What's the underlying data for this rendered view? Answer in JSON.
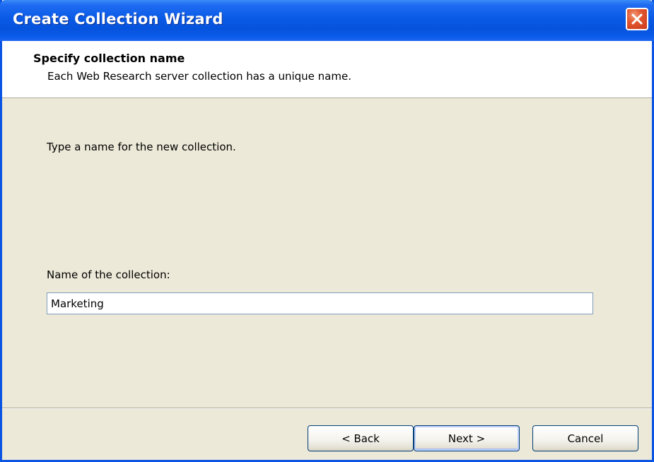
{
  "window": {
    "title": "Create Collection Wizard",
    "close_icon": "close-icon"
  },
  "header": {
    "title": "Specify collection name",
    "subtitle": "Each Web Research server collection has a unique name."
  },
  "body": {
    "instruction": "Type a name for the new collection.",
    "name_label": "Name of the collection:",
    "name_value": "Marketing"
  },
  "buttons": {
    "back": "< Back",
    "next": "Next >",
    "cancel": "Cancel"
  },
  "colors": {
    "titlebar": "#0a5ae6",
    "close_button": "#e2572f",
    "dialog_background": "#ece9d8",
    "header_background": "#ffffff",
    "input_border": "#7f9db9"
  }
}
